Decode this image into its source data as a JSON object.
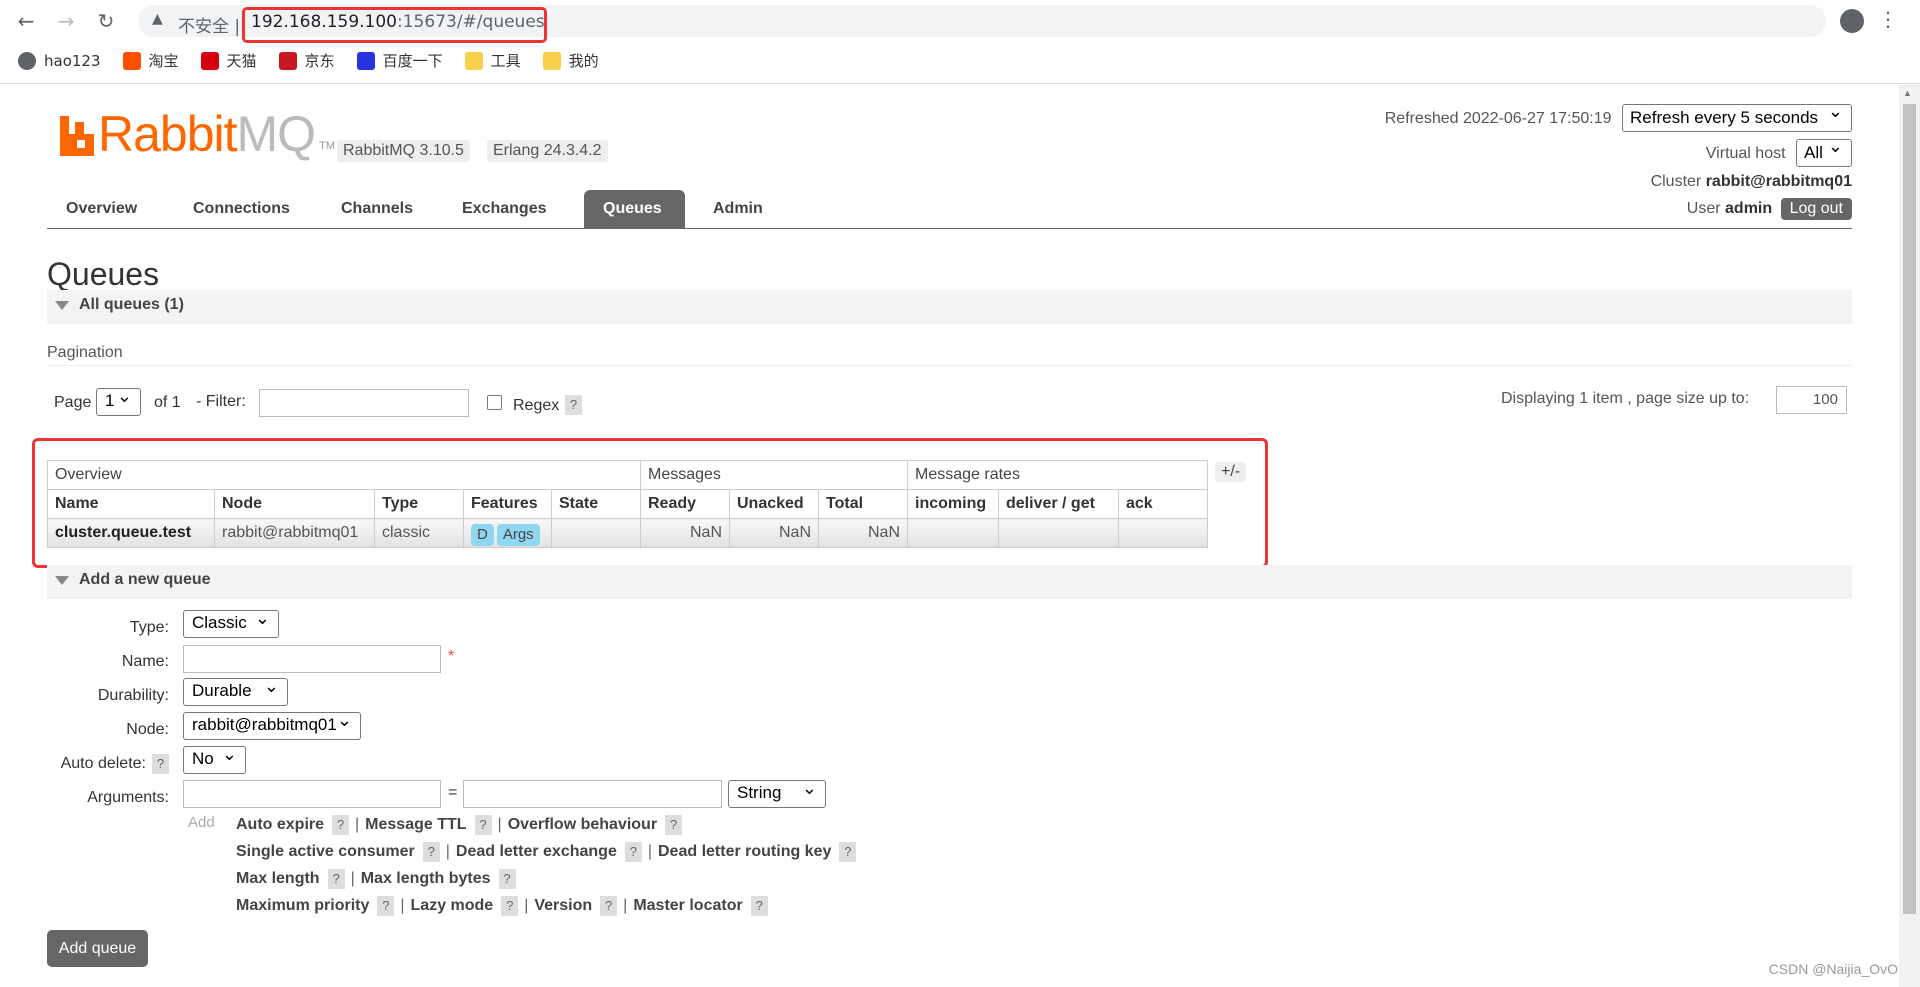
{
  "browser": {
    "insecure_label": "不安全",
    "separator": "|",
    "url_host": "192.168.159.100",
    "url_rest": ":15673/#/queues",
    "bookmarks": [
      {
        "label": "hao123",
        "icon": "globe-icon",
        "color": "#5f6368"
      },
      {
        "label": "淘宝",
        "icon": "taobao-icon",
        "color": "#ff5000"
      },
      {
        "label": "天猫",
        "icon": "tmall-icon",
        "color": "#d6000f"
      },
      {
        "label": "京东",
        "icon": "jd-icon",
        "color": "#c91623"
      },
      {
        "label": "百度一下",
        "icon": "baidu-icon",
        "color": "#2932e1"
      },
      {
        "label": "工具",
        "icon": "folder-icon",
        "color": "#f7cf4a"
      },
      {
        "label": "我的",
        "icon": "folder-icon",
        "color": "#f7cf4a"
      }
    ]
  },
  "header": {
    "logo_rabbit": "Rabbit",
    "logo_mq": "MQ",
    "logo_tm": "TM",
    "rabbitmq_version": "RabbitMQ 3.10.5",
    "erlang_version": "Erlang 24.3.4.2",
    "refreshed": "Refreshed 2022-06-27 17:50:19",
    "refresh_option": "Refresh every 5 seconds",
    "virtual_host_label": "Virtual host",
    "virtual_host_value": "All",
    "cluster_label": "Cluster",
    "cluster_value": "rabbit@rabbitmq01",
    "user_label": "User",
    "user_value": "admin",
    "logout": "Log out"
  },
  "tabs": [
    "Overview",
    "Connections",
    "Channels",
    "Exchanges",
    "Queues",
    "Admin"
  ],
  "active_tab": "Queues",
  "page_title": "Queues",
  "all_queues": {
    "header": "All queues (1)",
    "pagination_label": "Pagination",
    "page_label": "Page",
    "page_value": "1",
    "of_label": "of 1",
    "filter_label": "- Filter:",
    "filter_value": "",
    "regex_label": "Regex",
    "help": "?",
    "displaying": "Displaying 1 item , page size up to:",
    "page_size": "100",
    "plus_minus": "+/-",
    "groups": [
      "Overview",
      "Messages",
      "Message rates"
    ],
    "columns": [
      "Name",
      "Node",
      "Type",
      "Features",
      "State",
      "Ready",
      "Unacked",
      "Total",
      "incoming",
      "deliver / get",
      "ack"
    ],
    "rows": [
      {
        "name": "cluster.queue.test",
        "node": "rabbit@rabbitmq01",
        "type": "classic",
        "features": [
          "D",
          "Args"
        ],
        "state": "",
        "ready": "NaN",
        "unacked": "NaN",
        "total": "NaN",
        "incoming": "",
        "deliver_get": "",
        "ack": ""
      }
    ]
  },
  "add_queue": {
    "header": "Add a new queue",
    "type_label": "Type:",
    "type_value": "Classic",
    "name_label": "Name:",
    "name_value": "",
    "required_mark": "*",
    "durability_label": "Durability:",
    "durability_value": "Durable",
    "node_label": "Node:",
    "node_value": "rabbit@rabbitmq01",
    "auto_delete_label": "Auto delete:",
    "auto_delete_value": "No",
    "arguments_label": "Arguments:",
    "equals": "=",
    "arg_type_value": "String",
    "add_label": "Add",
    "arg_links": [
      [
        "Auto expire",
        "Message TTL",
        "Overflow behaviour"
      ],
      [
        "Single active consumer",
        "Dead letter exchange",
        "Dead letter routing key"
      ],
      [
        "Max length",
        "Max length bytes"
      ],
      [
        "Maximum priority",
        "Lazy mode",
        "Version",
        "Master locator"
      ]
    ],
    "submit": "Add queue"
  },
  "watermark": "CSDN @Naijia_OvO",
  "colors": {
    "accent": "#ff6600",
    "tab_active": "#666666",
    "highlight": "#ee3333",
    "feature_badge": "#8fd6f0"
  }
}
